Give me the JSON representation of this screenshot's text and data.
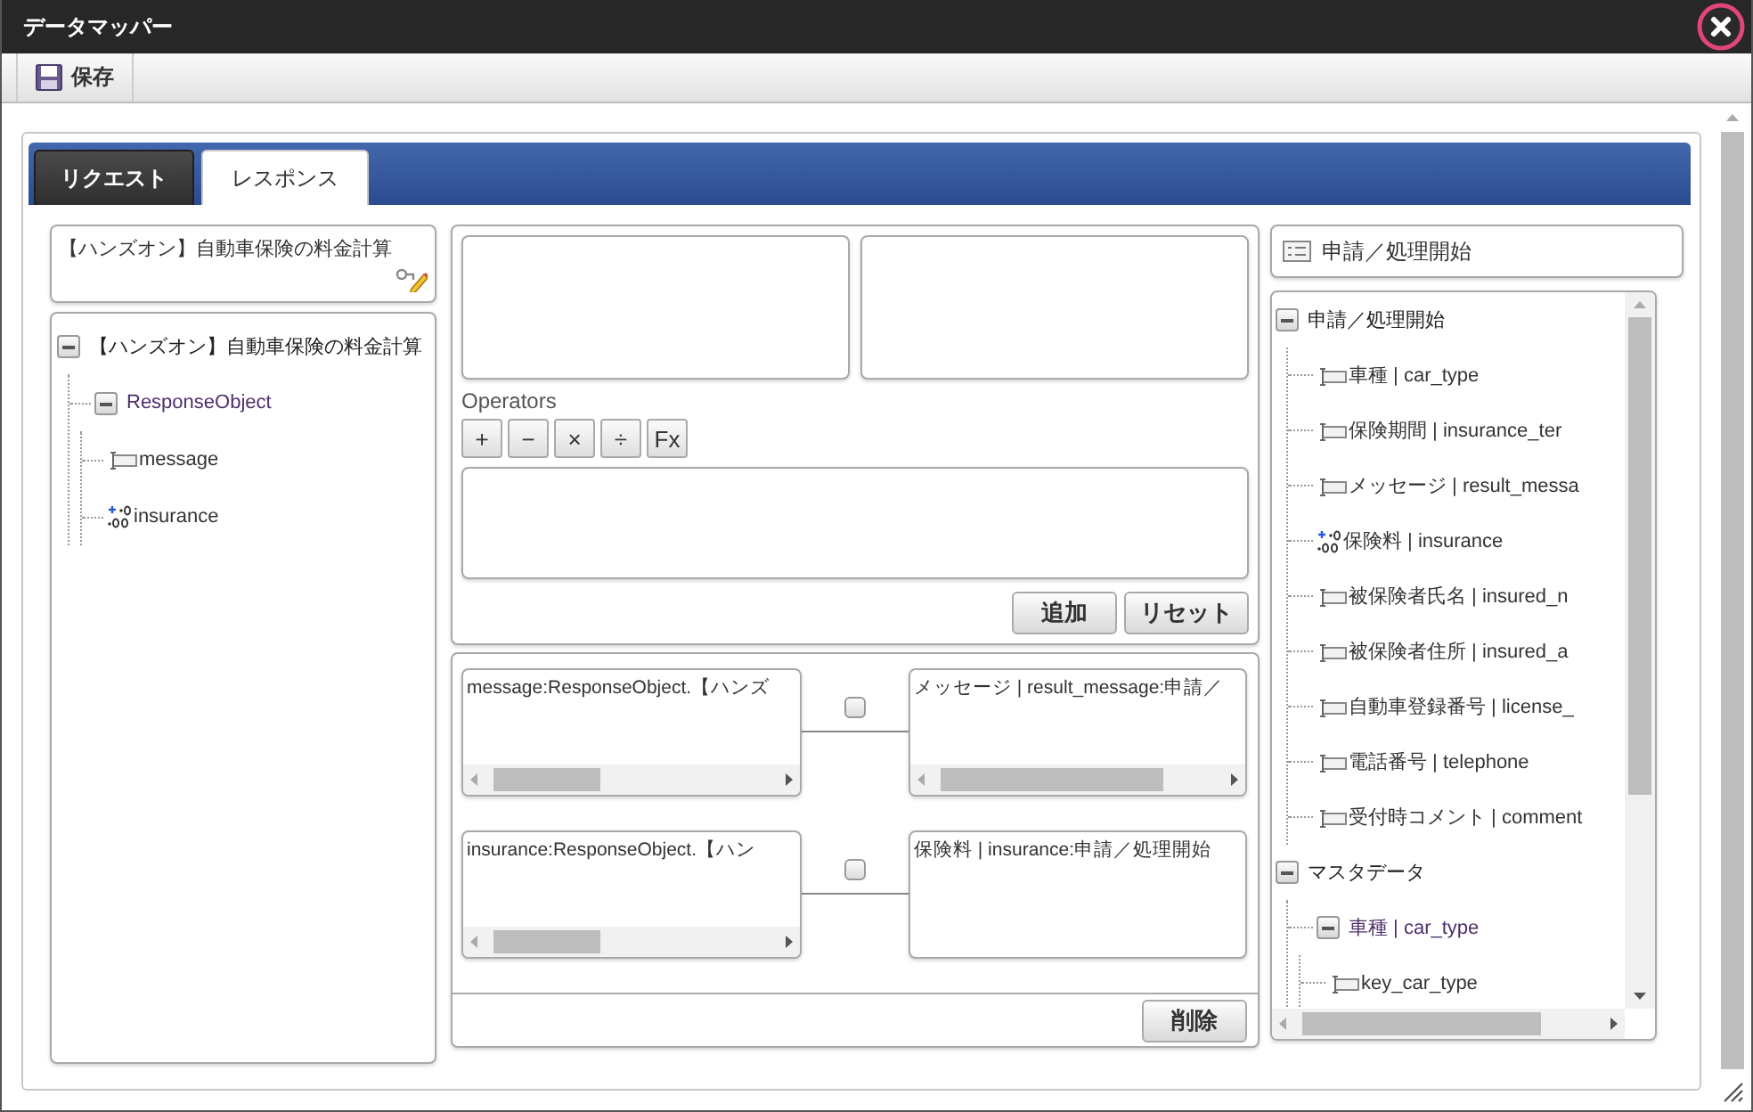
{
  "window": {
    "title": "データマッパー"
  },
  "toolbar": {
    "buttons": [
      {
        "label": "保存",
        "kind": "save"
      }
    ]
  },
  "tabs": [
    {
      "label": "リクエスト",
      "selected": false
    },
    {
      "label": "レスポンス",
      "selected": true
    }
  ],
  "source": {
    "title": "【ハンズオン】自動車保険の料金計算",
    "tree": [
      {
        "label": "【ハンズオン】自動車保険の料金計算",
        "kind": "group",
        "expanded": true,
        "children": [
          {
            "label": "ResponseObject",
            "kind": "object",
            "expanded": true,
            "children": [
              {
                "label": "message",
                "kind": "string"
              },
              {
                "label": "insurance",
                "kind": "number"
              }
            ]
          }
        ]
      }
    ]
  },
  "expression": {
    "operators_label": "Operators",
    "operators": [
      "+",
      "−",
      "×",
      "÷",
      "Fx"
    ],
    "buttons": [
      "追加",
      "リセット"
    ]
  },
  "mappings": {
    "rows": [
      {
        "source": "message:ResponseObject.【ハンズ",
        "target": "メッセージ | result_message:申請／",
        "checked": false,
        "target_scrollbar": true
      },
      {
        "source": "insurance:ResponseObject.【ハン",
        "target": "保険料 | insurance:申請／処理開始",
        "checked": false,
        "target_scrollbar": false
      }
    ],
    "delete_button": "削除"
  },
  "target": {
    "title": "申請／処理開始",
    "tree": [
      {
        "label": "申請／処理開始",
        "kind": "group",
        "expanded": true,
        "children": [
          {
            "label": "車種 | car_type",
            "kind": "string"
          },
          {
            "label": "保険期間 | insurance_ter",
            "kind": "string"
          },
          {
            "label": "メッセージ | result_messa",
            "kind": "string"
          },
          {
            "label": "保険料 | insurance",
            "kind": "number"
          },
          {
            "label": "被保険者氏名 | insured_n",
            "kind": "string"
          },
          {
            "label": "被保険者住所 | insured_a",
            "kind": "string"
          },
          {
            "label": "自動車登録番号 | license_",
            "kind": "string"
          },
          {
            "label": "電話番号 | telephone",
            "kind": "string"
          },
          {
            "label": "受付時コメント | comment",
            "kind": "string"
          }
        ]
      },
      {
        "label": "マスタデータ",
        "kind": "group",
        "expanded": true,
        "children": [
          {
            "label": "車種 | car_type",
            "kind": "object",
            "expanded": true,
            "children": [
              {
                "label": "key_car_type",
                "kind": "string"
              }
            ]
          }
        ]
      }
    ]
  }
}
